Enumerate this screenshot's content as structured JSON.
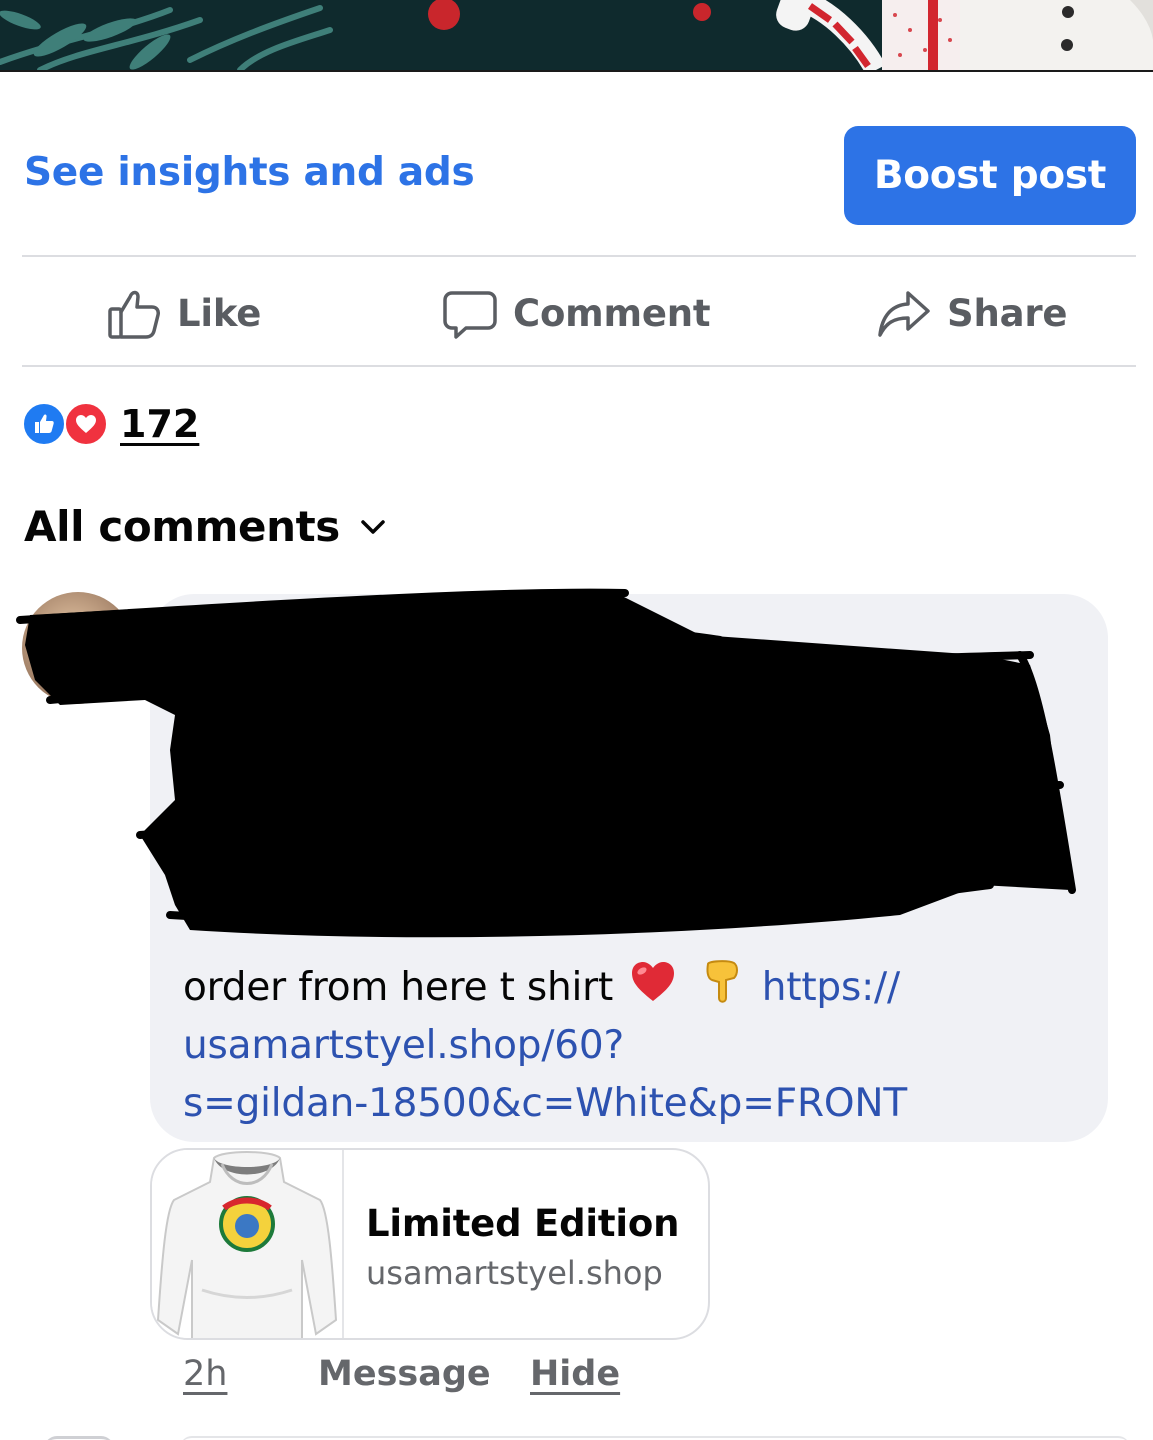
{
  "post_actions": {
    "insights_label": "See insights and ads",
    "boost_label": "Boost post"
  },
  "action_bar": {
    "like": {
      "label": "Like",
      "icon": "thumbs-up-icon"
    },
    "comment": {
      "label": "Comment",
      "icon": "speech-bubble-icon"
    },
    "share": {
      "label": "Share",
      "icon": "share-arrow-icon"
    }
  },
  "reactions": {
    "types": [
      "like",
      "love"
    ],
    "count": "172"
  },
  "comments_filter": {
    "label": "All comments",
    "icon": "chevron-down-icon"
  },
  "comment": {
    "text_plain": "order from here t shirt",
    "link_part1": "https://",
    "link_part2": "usamartstyel.shop/60?",
    "link_part3": "s=gildan-18500&c=White&p=FRONT",
    "link_preview": {
      "title": "Limited Edition",
      "domain": "usamartstyel.shop"
    },
    "time": "2h",
    "message_label": "Message",
    "hide_label": "Hide"
  },
  "colors": {
    "accent": "#2d73e6",
    "link": "#2d52b0",
    "muted": "#65676b",
    "bubble": "#f0f1f5",
    "like_reaction": "#1f7bf2",
    "love_reaction": "#f0323f"
  }
}
